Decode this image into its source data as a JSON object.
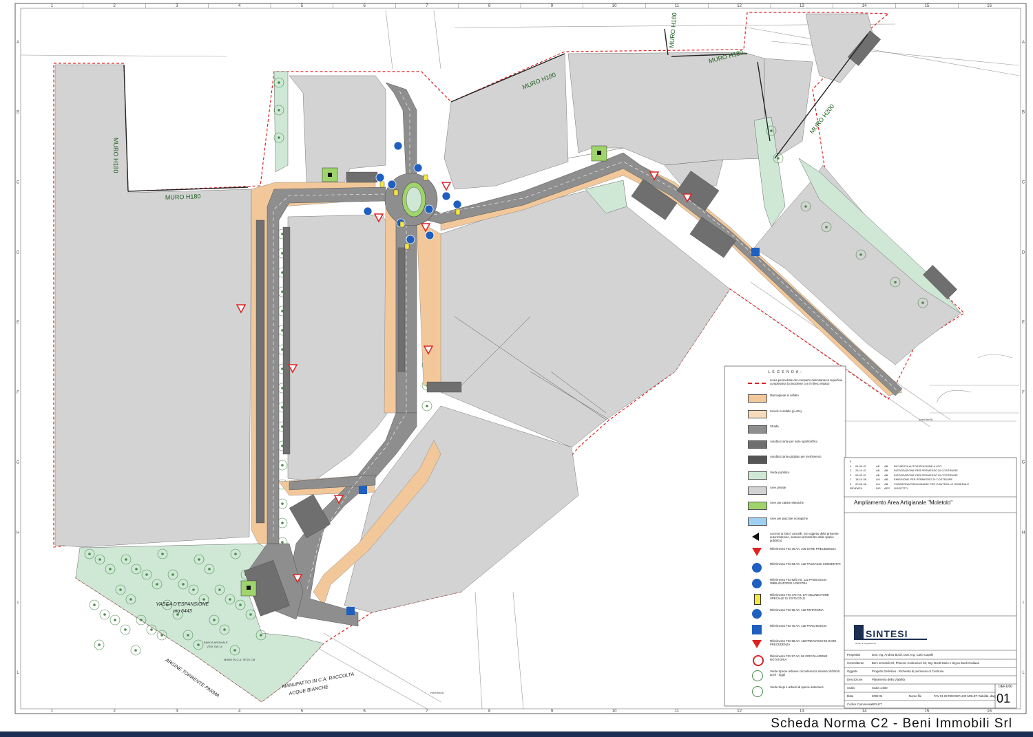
{
  "drawing": {
    "column_numbers": [
      "1",
      "2",
      "3",
      "4",
      "5",
      "6",
      "7",
      "8",
      "9",
      "10",
      "11",
      "12",
      "13",
      "14",
      "15",
      "16"
    ],
    "row_letters": [
      "A",
      "B",
      "C",
      "D",
      "E",
      "F",
      "G",
      "H",
      "I",
      "L"
    ],
    "wall_labels": [
      "MURO H180",
      "MURO H180",
      "MURO H180",
      "MURO H180",
      "MURO H180",
      "MURO H200"
    ],
    "expansion_basin": {
      "label": "VASCA D'ESPANSIONE",
      "area": "mq 6443"
    },
    "manufatto_label": [
      "MANUFATTO IN C.A. RACCOLTA",
      "ACQUE BIANCHE"
    ],
    "stream_label": "ARGINE TORRENTE PARMA",
    "bank_label": [
      "BANCA ARGINALE",
      "VEDI TAV.14"
    ],
    "wall_note": "MURO IN C.A. SP.25 CM",
    "verifica_label": "(vedi tav.5)"
  },
  "legend": {
    "title": "L E G E N D A :",
    "items": [
      {
        "text": "Linea perimetrale del comparto delimitante la superficie complessiva (coincidente con il rilievo visiato)",
        "symbol": "red-dashed-line"
      },
      {
        "text": "Marciapiede in asfalto",
        "symbol": "orange-fill",
        "color": "#f2c89a"
      },
      {
        "text": "Scivoli in asfalto (p=8%)",
        "symbol": "light-orange-fill",
        "color": "#f6dcbc"
      },
      {
        "text": "Strada",
        "symbol": "dark-grey-fill",
        "color": "#8e8e8e"
      },
      {
        "text": "Autobloccante per isole spartitraffico",
        "symbol": "grey-pattern-fill",
        "color": "#6f6f6f"
      },
      {
        "text": "Autobloccante grigliato per inerbimento",
        "symbol": "grid-pattern-fill",
        "color": "#555555"
      },
      {
        "text": "Verde pubblico",
        "symbol": "light-green-fill",
        "color": "#cfe8d6"
      },
      {
        "text": "Aree private",
        "symbol": "light-grey-fill",
        "color": "#d3d3d3"
      },
      {
        "text": "Aree per cabine elettriche",
        "symbol": "green-fill",
        "color": "#9fd36b"
      },
      {
        "text": "Aree per piazzole ecologiche",
        "symbol": "light-blue-fill",
        "color": "#9fd0f2"
      },
      {
        "text": "Accessi ai lotti (i cancelli, non oggetto della presente autorizzazione, saranno arretrati 5m dallo spazio pubblico)",
        "symbol": "black-arrow-icon"
      },
      {
        "text": "Riferimento FIG 36 Art. 106 DARE PRECEDENZA",
        "symbol": "yield-sign-icon"
      },
      {
        "text": "Riferimento FIG 83 Art. 122 PASSAGGI CONSENTITI",
        "symbol": "passage-allowed-sign-icon"
      },
      {
        "text": "Riferimento FIG 82/b Art. 122 PASSAGGIO OBBLIGATORIO A DESTRA",
        "symbol": "keep-right-sign-icon"
      },
      {
        "text": "Riferimento FIG 472 Art. 177 DELINEATORE SPECIALE DI OSTACOLO",
        "symbol": "delineator-icon"
      },
      {
        "text": "Riferimento FIG 96 Art. 122 ROTATORIA",
        "symbol": "roundabout-sign-icon"
      },
      {
        "text": "Riferimento FIG 75 Art. 120 PARCHEGGIO",
        "symbol": "parking-sign-icon"
      },
      {
        "text": "Riferimento FIG 58 Art. 118 PREAVVISO DI DARE PRECEDENZA",
        "symbol": "yield-warning-sign-icon"
      },
      {
        "text": "Riferimento FIG 57 Art. 96 CIRCOLAZIONE ROTATORIA",
        "symbol": "roundabout-warning-sign-icon"
      },
      {
        "text": "Verde Specie arboree circonferenza minima 18/20cm: aceri - tiggli",
        "symbol": "tree-icon"
      },
      {
        "text": "Verde Siepi e arbusti di specie autoctone",
        "symbol": "shrub-icon"
      }
    ]
  },
  "revisions": {
    "rows": [
      {
        "rev": "5",
        "date": "",
        "des": "",
        "app": "",
        "subject": ""
      },
      {
        "rev": "4",
        "date": "04-09-07",
        "des": "AB",
        "app": "AB",
        "subject": "RICHIESTA AUTORIZZAZIONE A.I.PO."
      },
      {
        "rev": "3",
        "date": "25-10-07",
        "des": "AB",
        "app": "AB",
        "subject": "INTEGRAZIONE PER PERMESSO DI COSTRUIRE"
      },
      {
        "rev": "2",
        "date": "09-02-07",
        "des": "AB",
        "app": "AB",
        "subject": "INTEGRAZIONE PER PERMESSO DI COSTRUIRE"
      },
      {
        "rev": "1",
        "date": "18-10-06",
        "des": "LM",
        "app": "AB",
        "subject": "EMISSIONE PER PERMESSO DI COSTRUIRE"
      },
      {
        "rev": "0",
        "date": "20-06-06",
        "des": "LM",
        "app": "AB",
        "subject": "CONSEGNA PRELIMINARE PER CONTROLLO GENERALE"
      }
    ],
    "header": {
      "rev": "REV.",
      "date": "DATA",
      "des": "DIS.",
      "app": "APP.",
      "subject": "OGGETTO"
    }
  },
  "title_block": {
    "project": "Ampliamento Area Artigianale \"Moletolo\"",
    "company": "SINTESI",
    "company_subline": "studio di progettazione",
    "rows": [
      {
        "key": "Progettisti",
        "value": "Dott. Ing. Andrea Bordi, Dott. Ing. Carlo Capelli"
      },
      {
        "key": "Committente",
        "value": "Beni Immobili Srl, Phoenix Costruzioni Srl, Sig. Bordi Dario e Sig.ra Bordi Giuliana"
      },
      {
        "key": "Oggetto",
        "value": "Progetto Definitivo - Richiesta di permesso di Costruire"
      },
      {
        "key": "Descrizione",
        "value": "Planimetria della Viabilità"
      },
      {
        "key": "Scala",
        "value": "Scala 1:500"
      },
      {
        "key": "Data",
        "value": "2002 04"
      },
      {
        "key": "Codice Commessa",
        "value": "MOLET"
      },
      {
        "key": "Nome file",
        "value": "TAV 01 02 R03 DEF.U00 MOLET Viabilità .dwg"
      }
    ],
    "sheet_code_label": "DEF.U00",
    "sheet_number": "01"
  },
  "footer": {
    "title": "Scheda Norma C2 - Beni Immobili Srl"
  }
}
